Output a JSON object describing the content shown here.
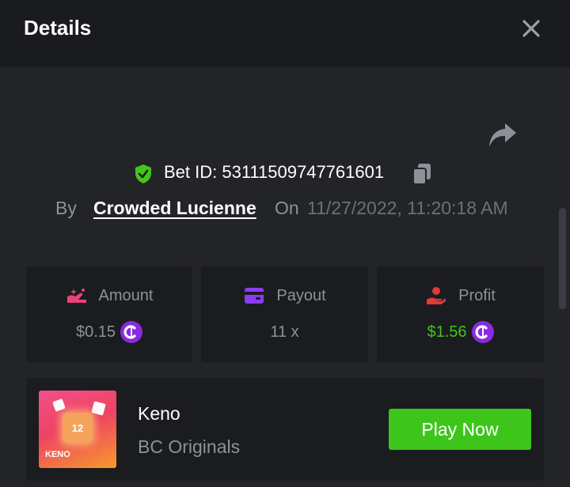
{
  "header": {
    "title": "Details",
    "close_icon": "close-icon"
  },
  "bet": {
    "id_label": "Bet ID: 53111509747761601",
    "by_label": "By",
    "user": "Crowded Lucienne",
    "on_label": "On",
    "datetime": "11/27/2022, 11:20:18 AM"
  },
  "stats": {
    "amount": {
      "label": "Amount",
      "value": "$0.15",
      "icon": "amount-icon"
    },
    "payout": {
      "label": "Payout",
      "value": "11 x",
      "icon": "wallet-icon"
    },
    "profit": {
      "label": "Profit",
      "value": "$1.56",
      "icon": "profit-hand-icon"
    }
  },
  "game": {
    "name": "Keno",
    "provider": "BC Originals",
    "thumb_number": "12",
    "thumb_title": "KENO",
    "play_label": "Play Now"
  },
  "colors": {
    "header_bg": "#1a1b1e",
    "page_bg": "#232428",
    "card_bg": "#1b1c1f",
    "accent_green": "#3ec51c",
    "profit_green": "#43c51b",
    "coin_purple": "#8a2be2"
  }
}
